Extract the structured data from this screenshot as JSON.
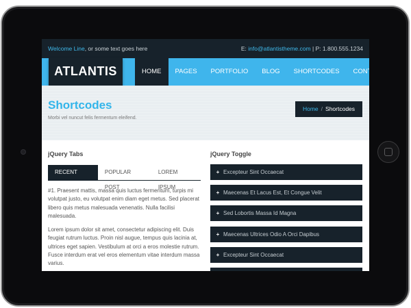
{
  "topbar": {
    "welcome_name": "Welcome Line",
    "welcome_rest": ", or some text goes here",
    "email_label": "E: ",
    "email": "info@atlantistheme.com",
    "phone": " | P: 1.800.555.1234"
  },
  "logo": "ATLANTIS",
  "menu": [
    "HOME",
    "PAGES",
    "PORTFOLIO",
    "BLOG",
    "SHORTCODES",
    "CONTACT"
  ],
  "header": {
    "title": "Shortcodes",
    "subtitle": "Morbi vel nuncut felis fermentum eleifend.",
    "breadcrumb_home": "Home",
    "breadcrumb_sep": "/",
    "breadcrumb_current": "Shortcodes"
  },
  "tabs_section": {
    "title": "jQuery Tabs",
    "tabs": [
      "RECENT POST",
      "POPULAR POST",
      "LOREM IPSUM"
    ],
    "paragraph1": "#1. Praesent mattis, massa quis luctus fermentum, turpis mi volutpat justo, eu volutpat enim diam eget metus. Sed placerat libero quis metus malesuada venenatis. Nulla facilisi malesuada.",
    "paragraph2": "Lorem ipsum dolor sit amet, consectetur adipiscing elit. Duis feugiat rutrum luctus. Proin nisl augue, tempus quis lacinia at, ultrices eget sapien. Vestibulum at orci a eros molestie rutrum. Fusce interdum erat vel eros elementum vitae interdum massa varius."
  },
  "toggle_section": {
    "title": "jQuery Toggle",
    "items": [
      "Excepteur Sint Occaecat",
      "Maecenas Et Lacus Est, Et Congue Velit",
      "Sed Lobortis Massa Id Magna",
      "Maecenas Ultrices Odio A Orci Dapibus",
      "Excepteur Sint Occaecat"
    ]
  },
  "colors": {
    "accent": "#3fb5ec",
    "dark": "#17222b"
  }
}
